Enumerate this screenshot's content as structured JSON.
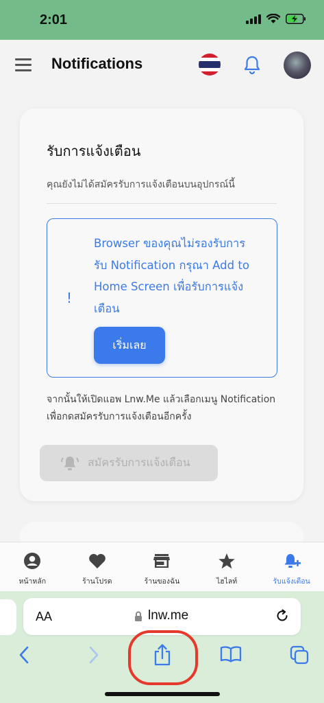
{
  "status_bar": {
    "time": "2:01"
  },
  "header": {
    "title": "Notifications"
  },
  "card": {
    "title": "รับการแจ้งเตือน",
    "subtitle": "คุณยังไม่ได้สมัครรับการแจ้งเตือนบนอุปกรณ์นี้",
    "alert": {
      "icon": "!",
      "text": "Browser ของคุณไม่รองรับการรับ Notification กรุณา Add to Home Screen เพื่อรับการแจ้งเตือน",
      "button_label": "เริ่มเลย"
    },
    "instruction": "จากนั้นให้เปิดแอพ Lnw.Me แล้วเลือกเมนู Notification เพื่อกดสมัครรับการแจ้งเตือนอีกครั้ง",
    "subscribe_label": "สมัครรับการแจ้งเตือน"
  },
  "bottom_nav": {
    "items": [
      {
        "label": "หน้าหลัก",
        "icon": "account-circle-icon"
      },
      {
        "label": "ร้านโปรด",
        "icon": "heart-icon"
      },
      {
        "label": "ร้านของฉัน",
        "icon": "store-icon"
      },
      {
        "label": "ไฮไลท์",
        "icon": "star-icon"
      },
      {
        "label": "รับแจ้งเตือน",
        "icon": "bell-plus-icon",
        "active": true
      }
    ]
  },
  "browser": {
    "aa_label": "AA",
    "url": "lnw.me"
  },
  "colors": {
    "status_bar": "#74bb8a",
    "accent": "#3b7ae8",
    "highlight": "#e5392b"
  }
}
